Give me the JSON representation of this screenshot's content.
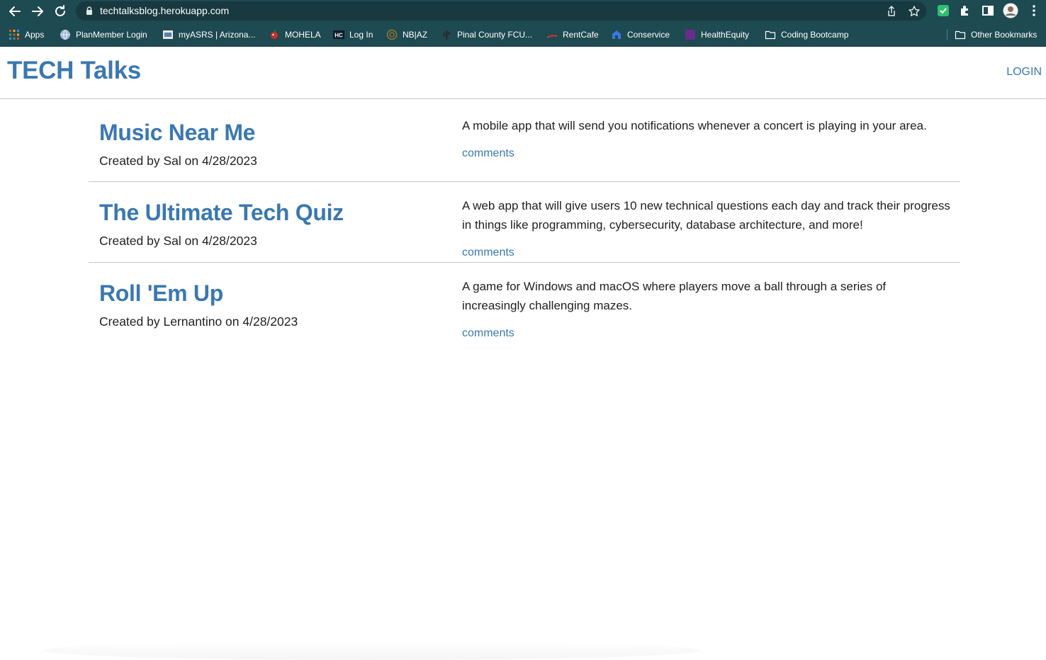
{
  "browser": {
    "url": "techtalksblog.herokuapp.com",
    "bookmarks": [
      {
        "label": "Apps",
        "icon": "apps-grid-icon",
        "color": "#e8a33a"
      },
      {
        "label": "PlanMember Login",
        "icon": "globe-icon",
        "color": "#9fb7d8"
      },
      {
        "label": "myASRS | Arizona...",
        "icon": "asrs-icon",
        "color": "#d8d8d8"
      },
      {
        "label": "MOHELA",
        "icon": "mohela-icon",
        "color": "#c9302c"
      },
      {
        "label": "Log In",
        "icon": "hc-icon",
        "color": "#0f1b2b"
      },
      {
        "label": "NB|AZ",
        "icon": "nbaz-icon",
        "color": "#a0782c"
      },
      {
        "label": "Pinal County FCU...",
        "icon": "cactus-icon",
        "color": "#2a2a2a"
      },
      {
        "label": "RentCafe",
        "icon": "rentcafe-icon",
        "color": "#d0342c"
      },
      {
        "label": "Conservice",
        "icon": "house-icon",
        "color": "#3c78e0"
      },
      {
        "label": "HealthEquity",
        "icon": "healthequity-icon",
        "color": "#6a2c8c"
      },
      {
        "label": "Coding Bootcamp",
        "icon": "folder-icon",
        "color": "#ffffff"
      },
      {
        "label": "Other Bookmarks",
        "icon": "folder-icon",
        "color": "#ffffff"
      }
    ]
  },
  "site": {
    "brand": "TECH Talks",
    "login": "LOGIN"
  },
  "posts": [
    {
      "title": "Music Near Me",
      "meta": "Created by Sal on 4/28/2023",
      "description": "A mobile app that will send you notifications whenever a concert is playing in your area.",
      "comments": "comments"
    },
    {
      "title": "The Ultimate Tech Quiz",
      "meta": "Created by Sal on 4/28/2023",
      "description": "A web app that will give users 10 new technical questions each day and track their progress in things like programming, cybersecurity, database architecture, and more!",
      "comments": "comments"
    },
    {
      "title": "Roll 'Em Up",
      "meta": "Created by Lernantino on 4/28/2023",
      "description": "A game for Windows and macOS where players move a ball through a series of increasingly challenging mazes.",
      "comments": "comments"
    }
  ],
  "colors": {
    "brand_blue": "#3a78b0",
    "chrome_teal": "#1e4a52"
  }
}
